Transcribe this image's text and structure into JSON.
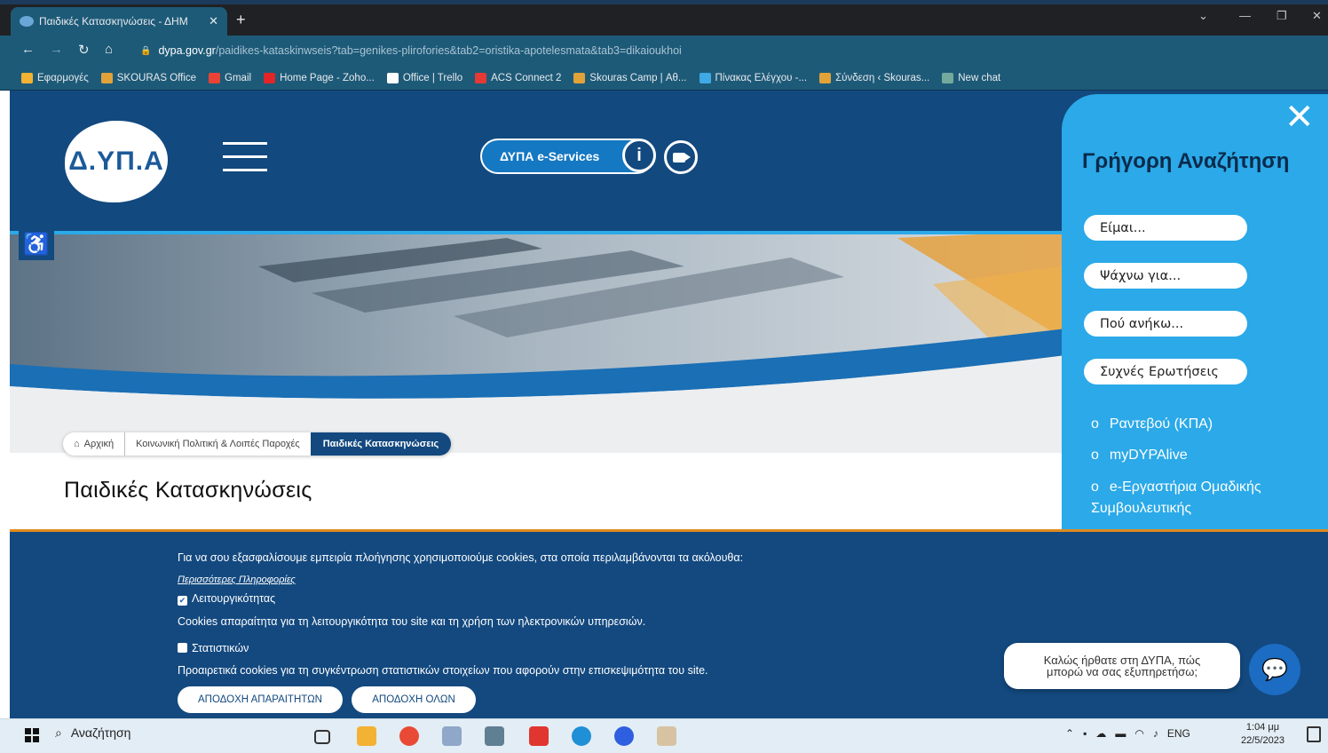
{
  "browser": {
    "tab_title": "Παιδικές Κατασκηνώσεις - ΔΗΜ",
    "tab_close": "✕",
    "new_tab": "+",
    "url_domain": "dypa.gov.gr",
    "url_path": "/paidikes-kataskinwseis?tab=genikes-plirofories&tab2=oristika-apotelesmata&tab3=dikaioukhoi",
    "window_controls": [
      "⌄",
      "—",
      "❐",
      "✕"
    ],
    "bookmarks": [
      {
        "label": "Εφαρμογές",
        "icon": "apps-icon",
        "color": "#f2b233"
      },
      {
        "label": "SKOURAS Office",
        "icon": "skouras-icon",
        "color": "#e1a23a"
      },
      {
        "label": "Gmail",
        "icon": "gmail-icon",
        "color": "#ea4335"
      },
      {
        "label": "Home Page - Zoho...",
        "icon": "zoho-icon",
        "color": "#e42527"
      },
      {
        "label": "Office | Trello",
        "icon": "trello-icon",
        "color": "#ffffff"
      },
      {
        "label": "ACS Connect 2",
        "icon": "acs-icon",
        "color": "#e53935"
      },
      {
        "label": "Skouras Camp | Αθ...",
        "icon": "skouras-icon",
        "color": "#e1a23a"
      },
      {
        "label": "Πίνακας Ελέγχου -...",
        "icon": "dashboard-icon",
        "color": "#3fa9e5"
      },
      {
        "label": "Σύνδεση ‹ Skouras...",
        "icon": "skouras-icon",
        "color": "#e1a23a"
      },
      {
        "label": "New chat",
        "icon": "chat-icon",
        "color": "#74aa9c"
      }
    ]
  },
  "site": {
    "logo_text": "Δ.ΥΠ.Α",
    "eservices_label": "ΔΥΠΑ e-Services",
    "info_label": "i",
    "accessibility_icon": "♿",
    "breadcrumb": [
      "Αρχική",
      "Κοινωνική Πολιτική & Λοιπές Παροχές",
      "Παιδικές Κατασκηνώσεις"
    ],
    "page_title": "Παιδικές Κατασκηνώσεις"
  },
  "quick_search": {
    "close": "✕",
    "title": "Γρήγορη Αναζήτηση",
    "buttons": [
      "Είμαι...",
      "Ψάχνω για...",
      "Πού ανήκω...",
      "Συχνές Ερωτήσεις"
    ],
    "links": [
      "Ραντεβού (ΚΠΑ)",
      "myDYPAlive",
      "e-Εργαστήρια Ομαδικής Συμβουλευτικής"
    ]
  },
  "cookies": {
    "intro": "Για να σου εξασφαλίσουμε εμπειρία πλοήγησης χρησιμοποιούμε cookies, στα οποία περιλαμβάνονται τα ακόλουθα:",
    "more_info": "Περισσότερες Πληροφορίες",
    "functional_label": "Λειτουργικότητας",
    "functional_checked": true,
    "functional_desc": "Cookies απαραίτητα για τη λειτουργικότητα του site και τη χρήση των ηλεκτρονικών υπηρεσιών.",
    "stats_label": "Στατιστικών",
    "stats_checked": false,
    "stats_desc": "Προαιρετικά cookies για τη συγκέντρωση στατιστικών στοιχείων που αφορούν στην επισκεψιμότητα του site.",
    "accept_required": "ΑΠΟΔΟΧΗ ΑΠΑΡΑΙΤΗΤΩΝ",
    "accept_all": "ΑΠΟΔΟΧΗ ΟΛΩΝ"
  },
  "chat": {
    "greeting_line1": "Καλώς ήρθατε στη ΔΥΠΑ, πώς",
    "greeting_line2": "μπορώ να σας εξυπηρετήσω;"
  },
  "taskbar": {
    "search_placeholder": "Αναζήτηση",
    "lang": "ENG",
    "time": "1:04 μμ",
    "date": "22/5/2023"
  },
  "colors": {
    "header_blue": "#12497f",
    "panel_blue": "#2ba9e8",
    "accent_orange": "#e08b1e"
  }
}
